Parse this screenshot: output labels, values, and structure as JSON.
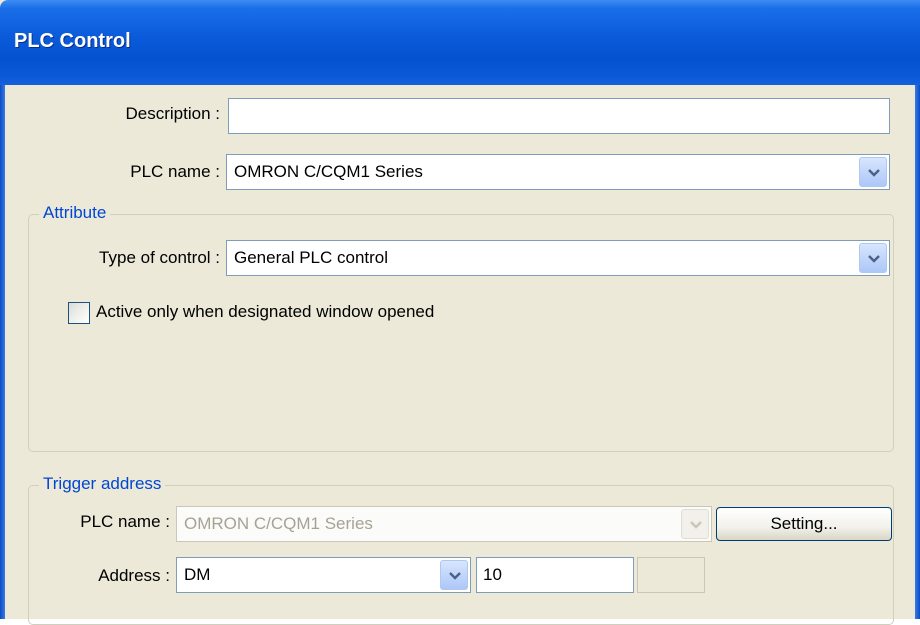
{
  "window": {
    "title": "PLC Control"
  },
  "form": {
    "description_label": "Description :",
    "description_value": "",
    "plc_name_label": "PLC name :",
    "plc_name_value": "OMRON C/CQM1 Series"
  },
  "attribute": {
    "legend": "Attribute",
    "type_label": "Type of control :",
    "type_value": "General PLC control",
    "checkbox_label": "Active only when designated window opened",
    "checkbox_checked": false
  },
  "trigger": {
    "legend": "Trigger address",
    "plc_name_label": "PLC name :",
    "plc_name_value": "OMRON C/CQM1 Series",
    "setting_label": "Setting...",
    "address_label": "Address :",
    "address_type": "DM",
    "address_value": "10",
    "extra_value": ""
  },
  "icons": {
    "dropdown": "chevron-down-icon",
    "checkbox": "checkbox-icon"
  }
}
